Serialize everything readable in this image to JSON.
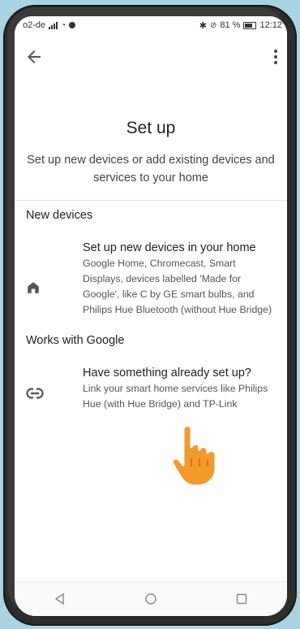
{
  "status_bar": {
    "carrier": "o2-de",
    "battery_text": "81 %",
    "time": "12:12"
  },
  "page": {
    "title": "Set up",
    "subtitle": "Set up new devices or add existing devices and services to your home"
  },
  "sections": [
    {
      "header": "New devices",
      "item": {
        "title": "Set up new devices in your home",
        "description": "Google Home, Chromecast, Smart Displays, devices labelled 'Made for Google', like C by GE smart bulbs, and Philips Hue Bluetooth (without Hue Bridge)",
        "icon": "home-icon"
      }
    },
    {
      "header": "Works with Google",
      "item": {
        "title": "Have something already set up?",
        "description": "Link your smart home services like Philips Hue (with Hue Bridge) and TP-Link",
        "icon": "link-icon"
      }
    }
  ],
  "colors": {
    "background": "#a8d4e3",
    "hand": "#f39a2b"
  }
}
